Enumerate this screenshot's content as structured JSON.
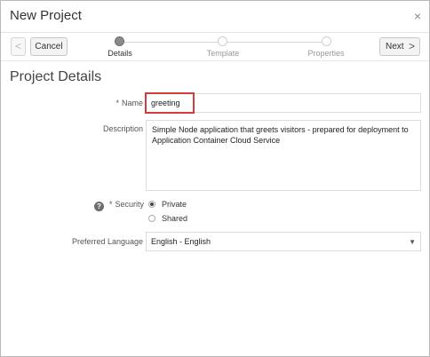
{
  "dialog": {
    "title": "New Project",
    "close_symbol": "×"
  },
  "toolbar": {
    "back_symbol": "<",
    "cancel_label": "Cancel",
    "next_label": "Next",
    "next_symbol": ">"
  },
  "train": {
    "steps": [
      {
        "label": "Details",
        "active": true
      },
      {
        "label": "Template",
        "active": false
      },
      {
        "label": "Properties",
        "active": false
      }
    ]
  },
  "section": {
    "title": "Project Details"
  },
  "form": {
    "name": {
      "required_mark": "*",
      "label": "Name",
      "value": "greeting"
    },
    "description": {
      "label": "Description",
      "value": "Simple Node application that greets visitors - prepared for deployment to Application Container Cloud Service"
    },
    "security": {
      "help_symbol": "?",
      "required_mark": "*",
      "label": "Security",
      "options": [
        {
          "label": "Private",
          "checked": true
        },
        {
          "label": "Shared",
          "checked": false
        }
      ]
    },
    "language": {
      "label": "Preferred Language",
      "value": "English - English",
      "arrow_symbol": "▼"
    }
  },
  "icons": {
    "close": "close-icon",
    "back": "chevron-left-icon",
    "next": "chevron-right-icon",
    "help": "help-icon",
    "dropdown": "dropdown-arrow-icon"
  },
  "colors": {
    "highlight": "#d33c3c",
    "active_step": "#8a8a8a"
  }
}
